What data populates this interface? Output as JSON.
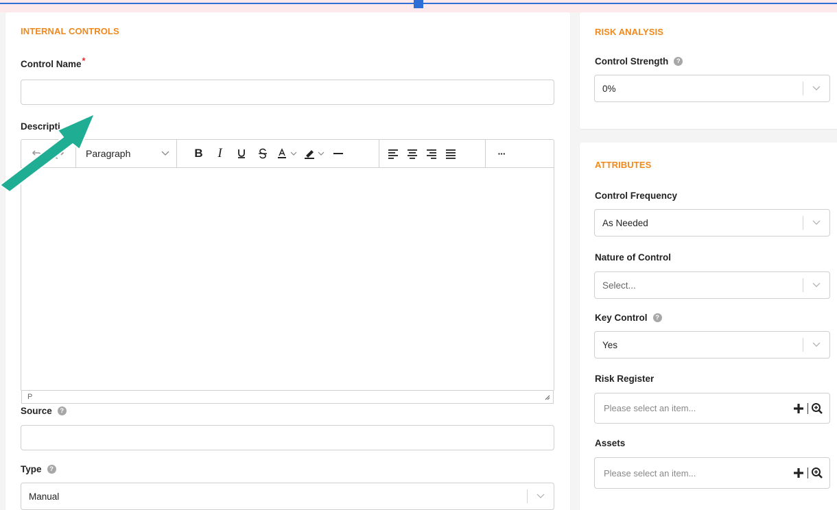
{
  "internal_controls": {
    "title": "INTERNAL CONTROLS",
    "control_name": {
      "label": "Control Name",
      "required_mark": "*",
      "value": ""
    },
    "description": {
      "label": "Description",
      "visible_label": "Descripti",
      "toolbar": {
        "block_format": "Paragraph",
        "more_label": "···"
      },
      "status_path": "P"
    },
    "source": {
      "label": "Source",
      "help": "?",
      "value": ""
    },
    "type": {
      "label": "Type",
      "help": "?",
      "value": "Manual"
    }
  },
  "risk_analysis": {
    "title": "RISK ANALYSIS",
    "control_strength": {
      "label": "Control Strength",
      "help": "?",
      "value": "0%"
    }
  },
  "attributes": {
    "title": "ATTRIBUTES",
    "control_frequency": {
      "label": "Control Frequency",
      "value": "As Needed"
    },
    "nature_of_control": {
      "label": "Nature of Control",
      "placeholder": "Select..."
    },
    "key_control": {
      "label": "Key Control",
      "help": "?",
      "value": "Yes"
    },
    "risk_register": {
      "label": "Risk Register",
      "placeholder": "Please select an item..."
    },
    "assets": {
      "label": "Assets",
      "placeholder": "Please select an item..."
    }
  },
  "colors": {
    "accent_orange": "#f0891d",
    "required_red": "#e12d2d",
    "annotation_arrow": "#1fae93",
    "top_line_blue": "#2d6fd6"
  },
  "icons": [
    "undo-icon",
    "redo-icon",
    "bold-icon",
    "italic-icon",
    "underline-icon",
    "strikethrough-icon",
    "text-color-icon",
    "highlight-icon",
    "horizontal-rule-icon",
    "align-left-icon",
    "align-center-icon",
    "align-right-icon",
    "justify-icon",
    "more-icon",
    "chevron-down-icon",
    "plus-icon",
    "zoom-in-icon",
    "help-icon",
    "annotation-arrow"
  ]
}
